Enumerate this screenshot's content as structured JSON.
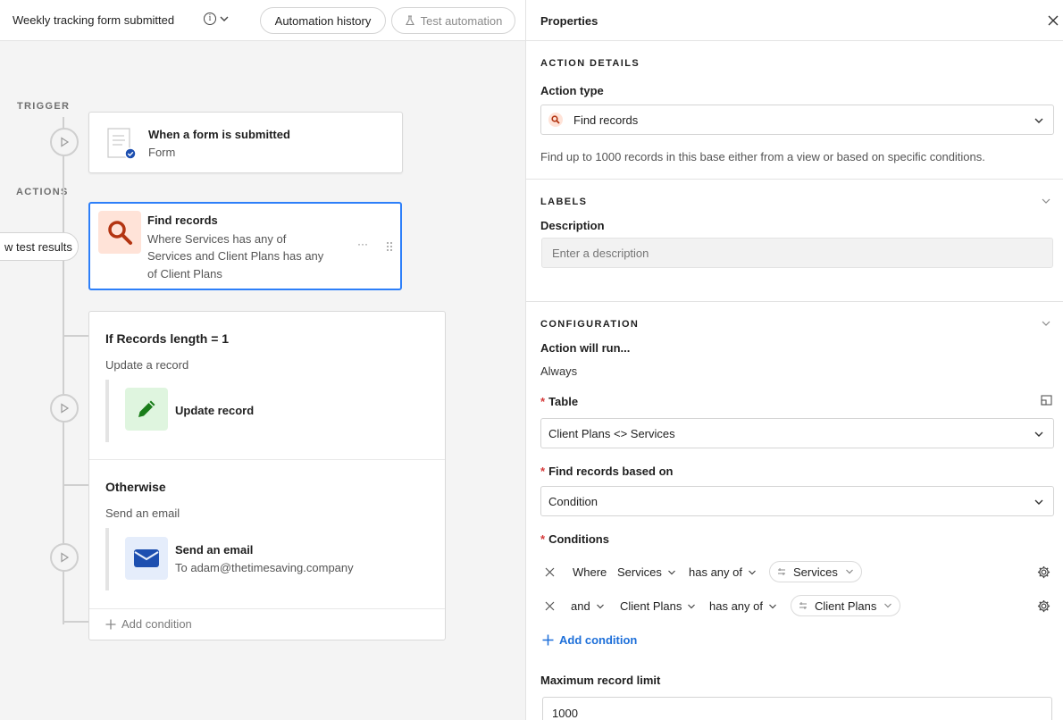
{
  "topbar": {
    "title": "Weekly tracking form submitted",
    "history_label": "Automation history",
    "test_label": "Test automation"
  },
  "canvas": {
    "trigger_label": "TRIGGER",
    "actions_label": "ACTIONS",
    "test_results_label": "w test results",
    "trigger_card": {
      "title": "When a form is submitted",
      "subtitle": "Form"
    },
    "find_card": {
      "title": "Find records",
      "line1": "Where Services has any of",
      "line2": "Services and Client Plans has any",
      "line3": "of Client Plans",
      "more": "···"
    },
    "condition_card": {
      "if_heading": "If Records length = 1",
      "if_sub": "Update a record",
      "update_title": "Update record",
      "otherwise_heading": "Otherwise",
      "otherwise_sub": "Send an email",
      "email_title": "Send an email",
      "email_to": "To adam@thetimesaving.company",
      "add_condition": "Add condition"
    }
  },
  "panel": {
    "title": "Properties",
    "action_details_heading": "ACTION DETAILS",
    "action_type_label": "Action type",
    "action_type_value": "Find records",
    "action_type_help": "Find up to 1000 records in this base either from a view or based on specific conditions.",
    "labels_heading": "LABELS",
    "description_label": "Description",
    "description_placeholder": "Enter a description",
    "configuration_heading": "CONFIGURATION",
    "will_run_label": "Action will run...",
    "will_run_value": "Always",
    "table_label": "Table",
    "table_value": "Client Plans <> Services",
    "based_on_label": "Find records based on",
    "based_on_value": "Condition",
    "conditions_label": "Conditions",
    "conditions": [
      {
        "conjunction": "Where",
        "field": "Services",
        "operator": "has any of",
        "value": "Services"
      },
      {
        "conjunction": "and",
        "field": "Client Plans",
        "operator": "has any of",
        "value": "Client Plans"
      }
    ],
    "add_condition_label": "Add condition",
    "max_limit_label": "Maximum record limit",
    "max_limit_value": "1000"
  },
  "colors": {
    "accent_blue": "#2d7ff9",
    "find_icon_bg": "#ffe3d8",
    "find_icon_fg": "#b33411",
    "update_icon_bg": "#dff5df",
    "update_icon_fg": "#1a7d1a",
    "email_icon_bg": "#e5edfb",
    "email_icon_fg": "#1d4fb0",
    "required_red": "#d53a3a",
    "link_blue": "#1d6fd9"
  }
}
